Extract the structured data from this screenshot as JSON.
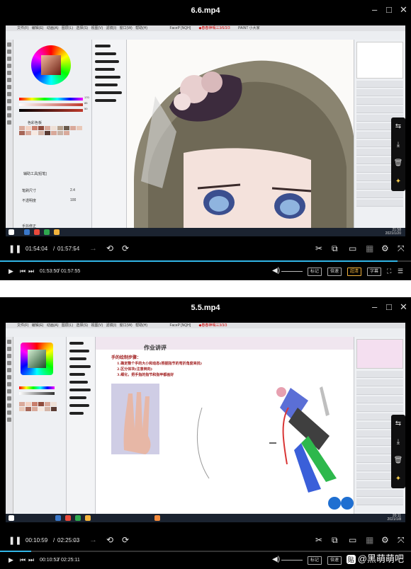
{
  "players": [
    {
      "title": "6.6.mp4",
      "window_controls": [
        "–",
        "□",
        "✕"
      ],
      "software": {
        "app_tabs": [
          "FaceP [NQH]",
          "◆春春神鳴三3/6/3/3",
          "PAINT 小大家"
        ],
        "menu": [
          "文件(F)",
          "编辑(E)",
          "动画(A)",
          "图层(L)",
          "选择(S)",
          "视图(V)",
          "滤镜(I)",
          "窗口(W)",
          "帮助(H)"
        ],
        "color_values": [
          "170",
          "85",
          "50"
        ],
        "palette_label": "色彩色板",
        "subtool_label": "辅助工具[铅笔]",
        "brush_size_label": "笔刷尺寸",
        "brush_size_value": "2.4",
        "opacity_label": "不透明度",
        "opacity_value": "100",
        "stabilization_label": "手抖修正",
        "clock_time": "21:58",
        "clock_date": "2021/1/20"
      },
      "playback": {
        "current_time": "01:54:04",
        "total_time": "01:57:54",
        "bottom_current": "01:53:50",
        "bottom_total": "01:57:55",
        "progress_fraction": 0.967,
        "quality_buttons": [
          "标记",
          "倍速",
          "超清",
          "字幕"
        ],
        "accent_color": "#31b6e7"
      }
    },
    {
      "title": "5.5.mp4",
      "window_controls": [
        "–",
        "□",
        "✕"
      ],
      "software": {
        "app_tabs": [
          "FaceP [NQH]",
          "◆春春神鳴三3/3/3"
        ],
        "menu": [
          "文件(F)",
          "编辑(E)",
          "动画(A)",
          "图层(L)",
          "选择(S)",
          "视图(V)",
          "滤镜(I)",
          "窗口(W)",
          "帮助(H)"
        ],
        "lesson_title": "作业讲评",
        "lesson_heading": "手的绘制步骤：",
        "lesson_steps": [
          "1.确定整个手的大小和动态(根据指节的弯折角度来找)",
          "2.区分体块(注意倒向)",
          "3.细化，把手指的指节和指甲都画好"
        ],
        "clock_time": "20:11",
        "clock_date": "2021/1/8"
      },
      "playback": {
        "current_time": "00:10:59",
        "total_time": "02:25:03",
        "bottom_current": "00:10:52",
        "bottom_total": "02:25:11",
        "progress_fraction": 0.075,
        "quality_buttons": [
          "标记",
          "倍速",
          "超清",
          "字幕"
        ],
        "accent_color": "#31b6e7"
      },
      "watermark": "@黑萌萌吧",
      "watermark_badge": "贴"
    }
  ]
}
